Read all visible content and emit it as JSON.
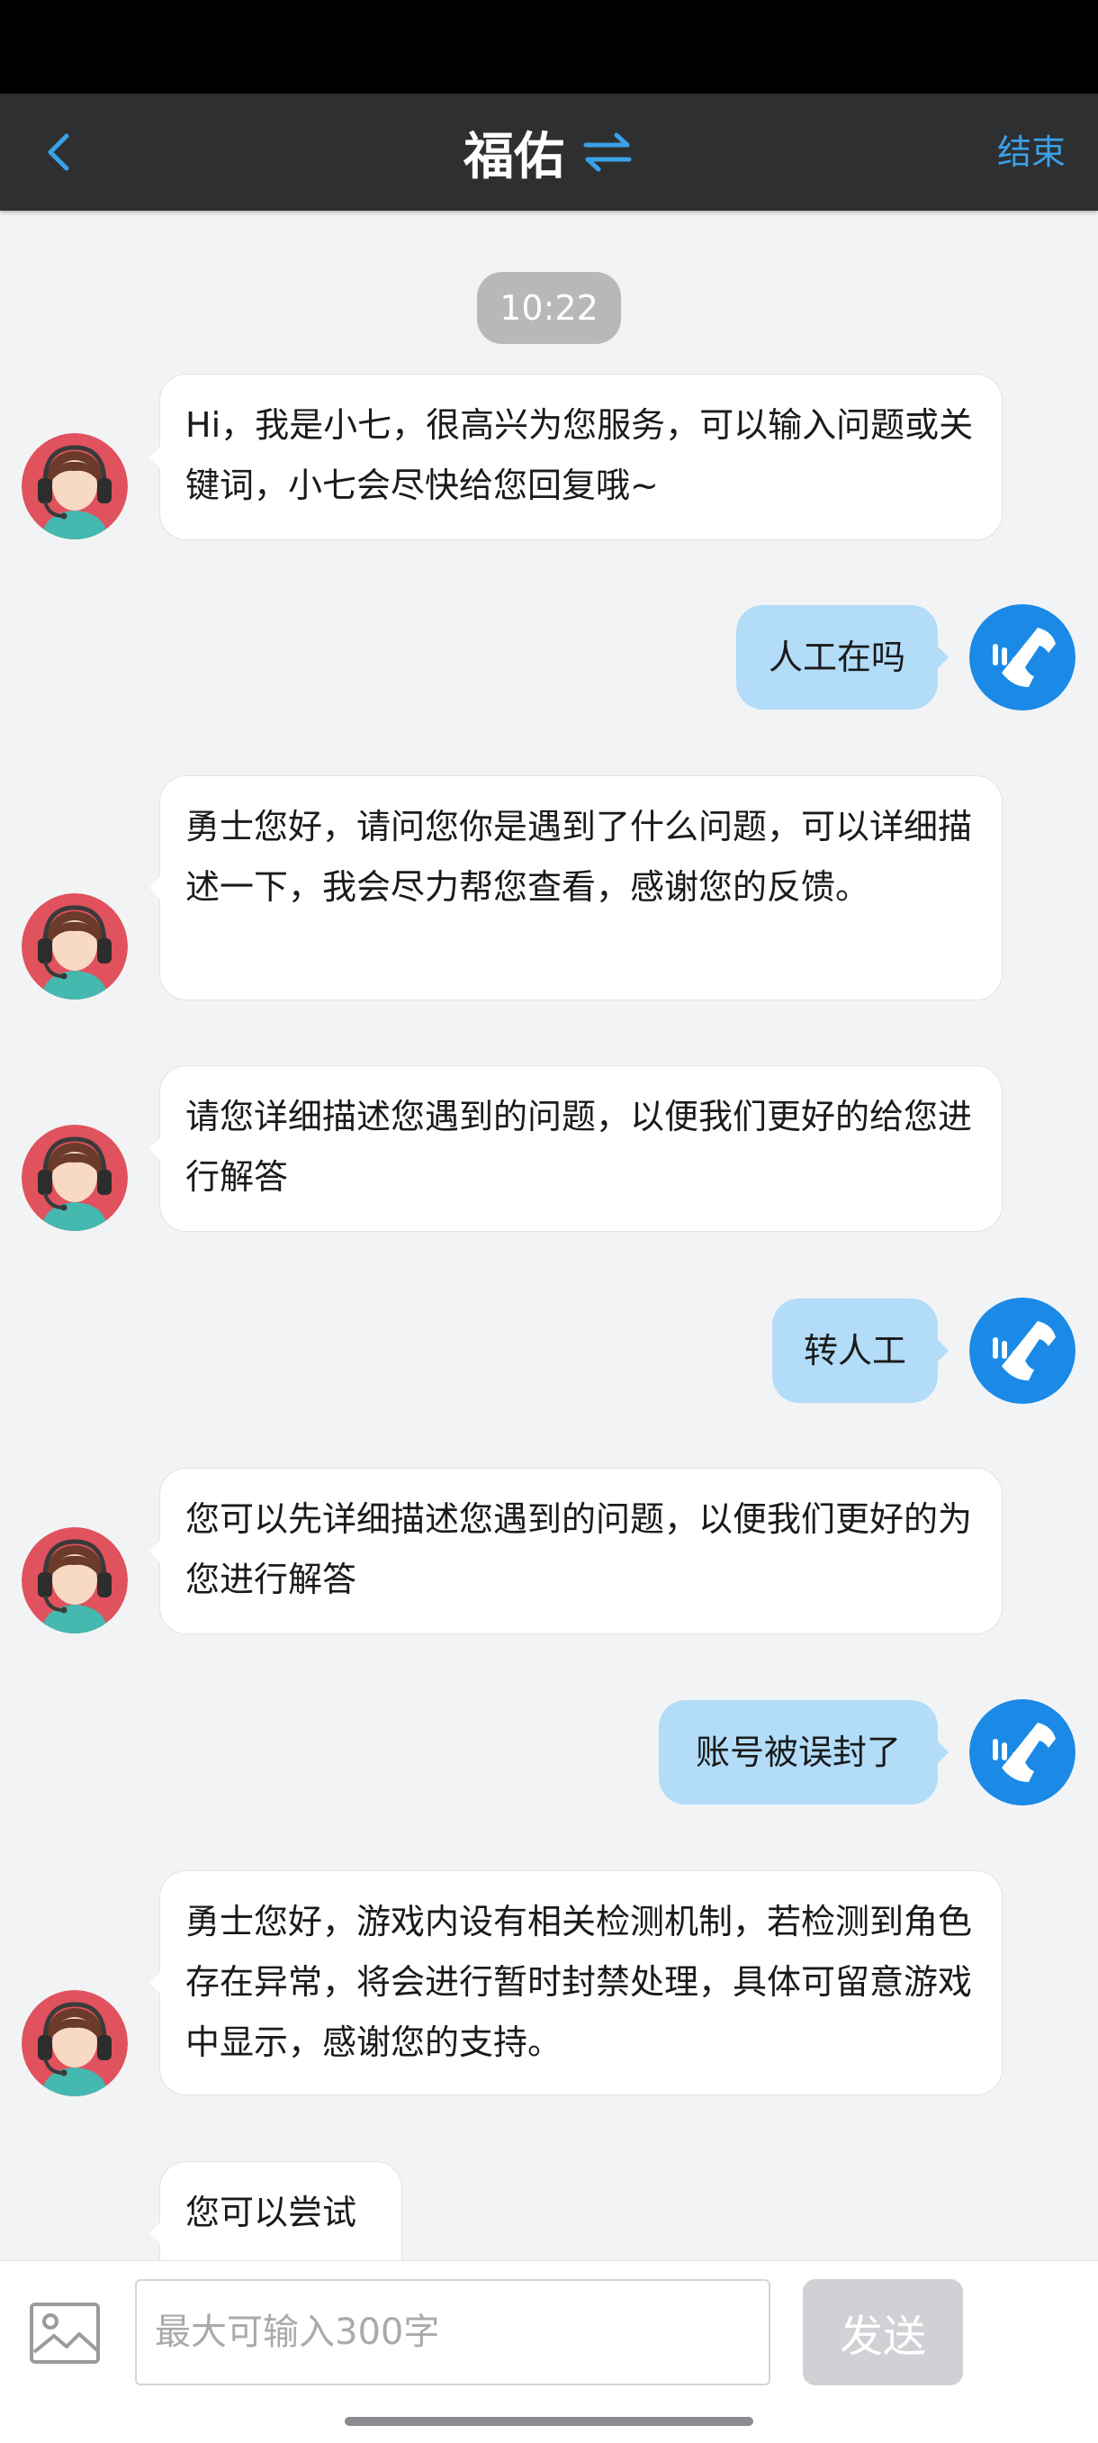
{
  "header": {
    "title": "福佑",
    "end_label": "结束",
    "background": "#2e2f31",
    "accent": "#3aa0e8"
  },
  "chat": {
    "timestamp": "10:22",
    "messages": [
      {
        "sender": "agent",
        "text": "Hi，我是小七，很高兴为您服务，可以输入问题或关键词，小七会尽快给您回复哦~"
      },
      {
        "sender": "user",
        "text": "人工在吗"
      },
      {
        "sender": "agent",
        "text": "勇士您好，请问您你是遇到了什么问题，可以详细描述一下，我会尽力帮您查看，感谢您的反馈。"
      },
      {
        "sender": "agent",
        "text": "请您详细描述您遇到的问题，以便我们更好的给您进行解答"
      },
      {
        "sender": "user",
        "text": "转人工"
      },
      {
        "sender": "agent",
        "text": "您可以先详细描述您遇到的问题，以便我们更好的为您进行解答"
      },
      {
        "sender": "user",
        "text": "账号被误封了"
      },
      {
        "sender": "agent",
        "text": "勇士您好，游戏内设有相关检测机制，若检测到角色存在异常，将会进行暂时封禁处理，具体可留意游戏中显示，感谢您的支持。"
      },
      {
        "sender": "agent",
        "text": "您可以尝试"
      }
    ],
    "user_bubble_color": "#b2dcf8",
    "agent_bubble_color": "#ffffff"
  },
  "input": {
    "placeholder": "最大可输入300字",
    "send_label": "发送"
  },
  "icons": {
    "back": "chevron-left-icon",
    "swap": "swap-arrows-icon",
    "agent_avatar": "headset-agent-avatar",
    "user_avatar": "phone-logo-avatar",
    "image": "image-icon"
  }
}
